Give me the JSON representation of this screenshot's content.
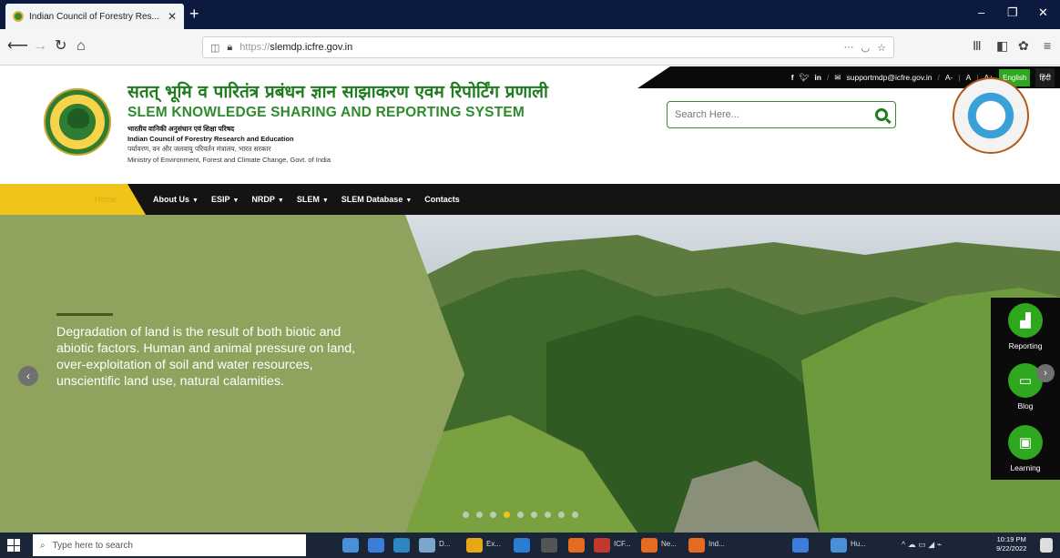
{
  "browser": {
    "tab_title": "Indian Council of Forestry Res...",
    "tab_close": "✕",
    "new_tab": "+",
    "url_prefix": "https://",
    "url_domain": "slemdp.icfre.gov.in",
    "window_minimize": "–",
    "window_maximize": "❐",
    "window_close": "✕"
  },
  "header": {
    "hindi_title": "सतत् भूमि व पारितंत्र प्रबंधन ज्ञान साझाकरण एवम रिपोर्टिंग प्रणाली",
    "english_title": "SLEM KNOWLEDGE SHARING AND REPORTING SYSTEM",
    "org_hindi": "भारतीय वानिकी अनुसंधान एवं शिक्षा परिषद",
    "org_english": "Indian Council of Forestry Research and Education",
    "ministry_hindi": "पर्यावरण, वन और जलवायु परिवर्तन मंत्रालय, भारत सरकार",
    "ministry_english": "Ministry of Environment, Forest and Climate Change, Govt. of India",
    "email": "supportmdp@icfre.gov.in",
    "font_controls": [
      "A-",
      "A",
      "A+"
    ],
    "lang_english": "English",
    "lang_hindi": "हिंदी",
    "search_placeholder": "Search Here..."
  },
  "menu": {
    "home": "Home",
    "items": [
      "About Us",
      "ESIP",
      "NRDP",
      "SLEM",
      "SLEM Database",
      "Contacts"
    ]
  },
  "hero": {
    "text": "Degradation of land is the result of both biotic and abiotic factors. Human and animal pressure on land, over-exploitation of soil and water resources, unscientific land use, natural calamities.",
    "active_slide": 3,
    "slide_count": 9
  },
  "sidebar": {
    "items": [
      {
        "label": "Reporting",
        "icon": "chart-icon"
      },
      {
        "label": "Blog",
        "icon": "chat-icon"
      },
      {
        "label": "Learning",
        "icon": "presentation-icon"
      }
    ]
  },
  "taskbar": {
    "search_placeholder": "Type here to search",
    "apps": [
      "D...",
      "Ex...",
      "ICF...",
      "Ne...",
      "Ind...",
      "Hu..."
    ],
    "time": "10:19 PM",
    "date": "9/22/2022"
  },
  "colors": {
    "brand_green": "#2fa81f",
    "accent_yellow": "#f0c419",
    "menu_bg": "#141414"
  }
}
